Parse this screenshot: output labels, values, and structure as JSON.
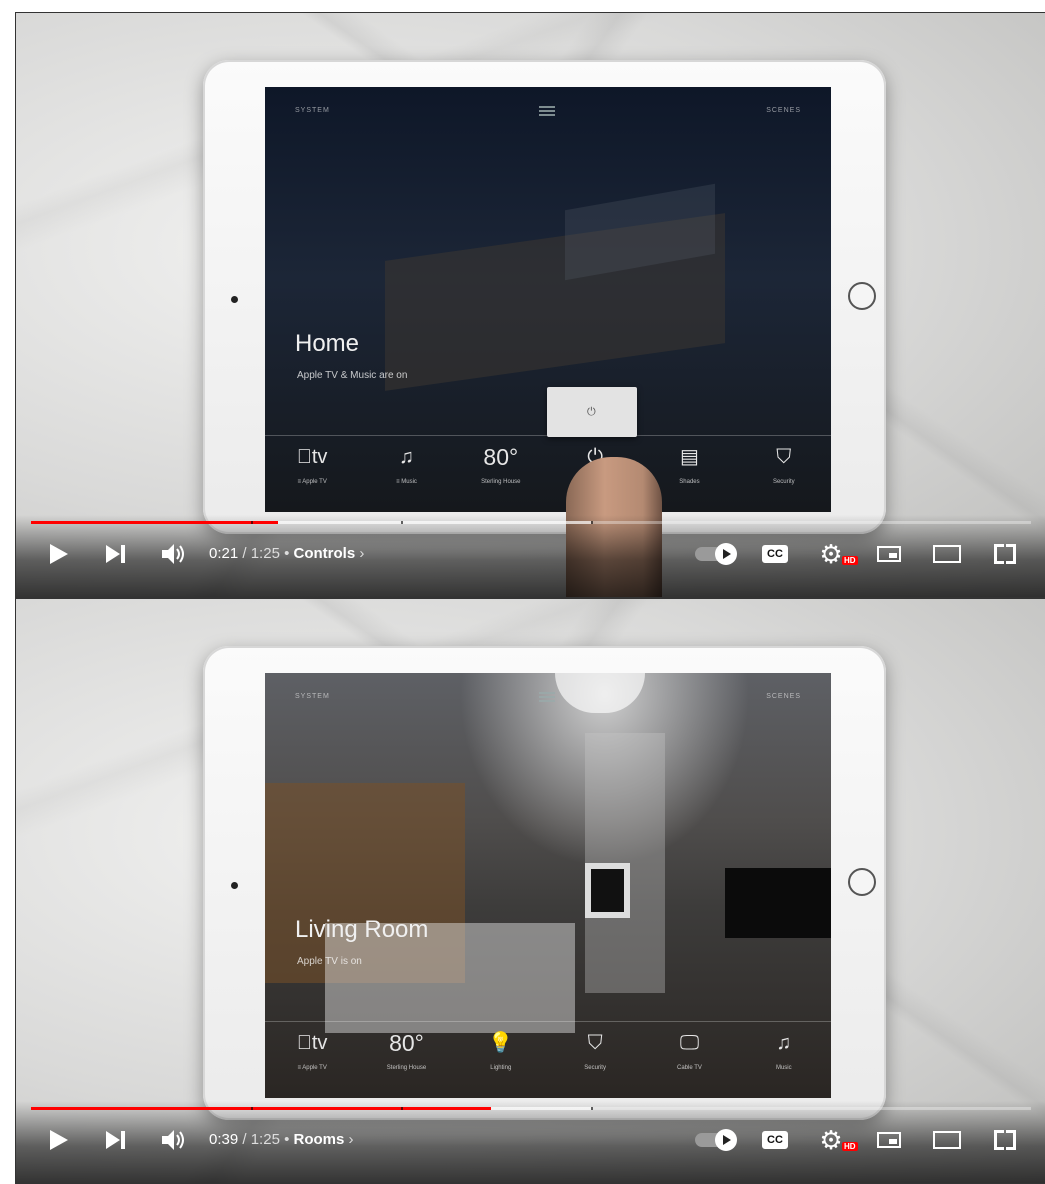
{
  "frames": [
    {
      "screen": {
        "top_left": "SYSTEM",
        "top_right": "SCENES",
        "title": "Home",
        "status": "Apple TV & Music are on",
        "dock": [
          {
            "glyph": "tv",
            "label": "≡ Apple TV",
            "icon": "apple-tv-icon"
          },
          {
            "glyph": "♫",
            "label": "≡ Music",
            "icon": "music-icon"
          },
          {
            "glyph": "80°",
            "label": "Sterling House",
            "icon": "thermostat-icon"
          },
          {
            "glyph": "⏻",
            "label": "",
            "icon": "power-icon"
          },
          {
            "glyph": "▤",
            "label": "Shades",
            "icon": "shades-icon"
          },
          {
            "glyph": "⛉",
            "label": "Security",
            "icon": "security-icon"
          }
        ],
        "power_popup_glyph": "⏻"
      },
      "player": {
        "current_time": "0:21",
        "duration": "1:25",
        "separator": " / ",
        "chapter": "Controls",
        "chapter_chevron": "›",
        "hd_badge": "HD",
        "cc_label": "CC",
        "played_fraction": 0.247,
        "buffered_fraction": 0.56
      }
    },
    {
      "screen": {
        "top_left": "SYSTEM",
        "top_right": "SCENES",
        "title": "Living Room",
        "status": "Apple TV is on",
        "dock": [
          {
            "glyph": "tv",
            "label": "≡ Apple TV",
            "icon": "apple-tv-icon"
          },
          {
            "glyph": "80°",
            "label": "Sterling House",
            "icon": "thermostat-icon"
          },
          {
            "glyph": "💡",
            "label": "Lighting",
            "icon": "lightbulb-icon"
          },
          {
            "glyph": "⛉",
            "label": "Security",
            "icon": "security-icon"
          },
          {
            "glyph": "🖵",
            "label": "Cable TV",
            "icon": "tv-icon"
          },
          {
            "glyph": "♫",
            "label": "Music",
            "icon": "music-icon"
          }
        ]
      },
      "player": {
        "current_time": "0:39",
        "duration": "1:25",
        "separator": " / ",
        "chapter": "Rooms",
        "chapter_chevron": "›",
        "hd_badge": "HD",
        "cc_label": "CC",
        "played_fraction": 0.46,
        "buffered_fraction": 0.56
      }
    }
  ],
  "colors": {
    "progress_played": "#ff0000",
    "hd_badge": "#ff0000"
  }
}
